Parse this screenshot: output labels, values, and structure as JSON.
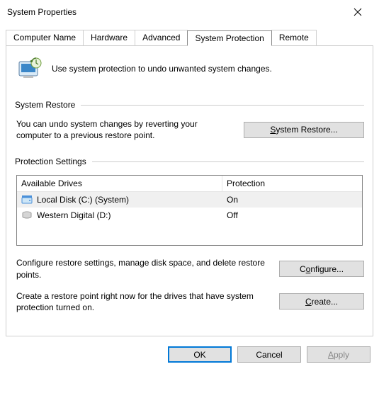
{
  "window": {
    "title": "System Properties"
  },
  "tabs": {
    "computer_name": "Computer Name",
    "hardware": "Hardware",
    "advanced": "Advanced",
    "system_protection": "System Protection",
    "remote": "Remote"
  },
  "intro_text": "Use system protection to undo unwanted system changes.",
  "system_restore": {
    "group_label": "System Restore",
    "description": "You can undo system changes by reverting your computer to a previous restore point.",
    "button_prefix": "",
    "button_text": "System Restore...",
    "button_underline": "S"
  },
  "protection_settings": {
    "group_label": "Protection Settings",
    "columns": {
      "drives": "Available Drives",
      "protection": "Protection"
    },
    "rows": [
      {
        "name": "Local Disk (C:) (System)",
        "protection": "On",
        "selected": true,
        "icon": "local"
      },
      {
        "name": "Western Digital (D:)",
        "protection": "Off",
        "selected": false,
        "icon": "ext"
      }
    ],
    "configure": {
      "description": "Configure restore settings, manage disk space, and delete restore points.",
      "button_text": "Configure...",
      "button_underline": "o",
      "button_prefix": "C",
      "button_suffix": "nfigure..."
    },
    "create": {
      "description": "Create a restore point right now for the drives that have system protection turned on.",
      "button_text": "Create...",
      "button_underline": "C",
      "button_suffix": "reate..."
    }
  },
  "dialog_buttons": {
    "ok": "OK",
    "cancel": "Cancel",
    "apply": "Apply",
    "apply_underline": "A",
    "apply_suffix": "pply"
  }
}
